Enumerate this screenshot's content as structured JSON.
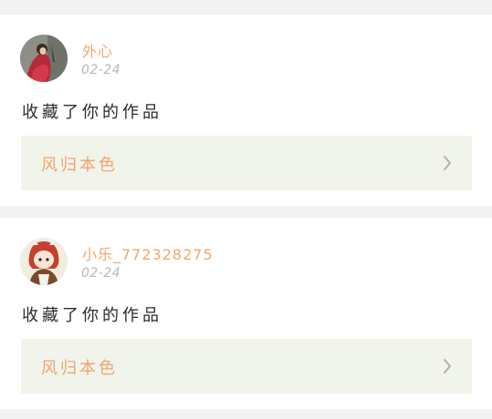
{
  "notifications": [
    {
      "username": "外心",
      "date": "02-24",
      "message": "收藏了你的作品",
      "work_title": "风归本色",
      "avatar_icon": "avatar-red-dress-girl",
      "chevron_icon": "chevron-right-icon"
    },
    {
      "username": "小乐_772328275",
      "date": "02-24",
      "message": "收藏了你的作品",
      "work_title": "风归本色",
      "avatar_icon": "avatar-cartoon-girl",
      "chevron_icon": "chevron-right-icon"
    }
  ],
  "colors": {
    "page_background": "#f2f2f2",
    "card_background": "#ffffff",
    "username": "#f2a86c",
    "date": "#b9b9b9",
    "message": "#2b2b2b",
    "work_link_background": "#f0f4ea",
    "work_title": "#f0a56f",
    "chevron": "#b0b0b0"
  }
}
